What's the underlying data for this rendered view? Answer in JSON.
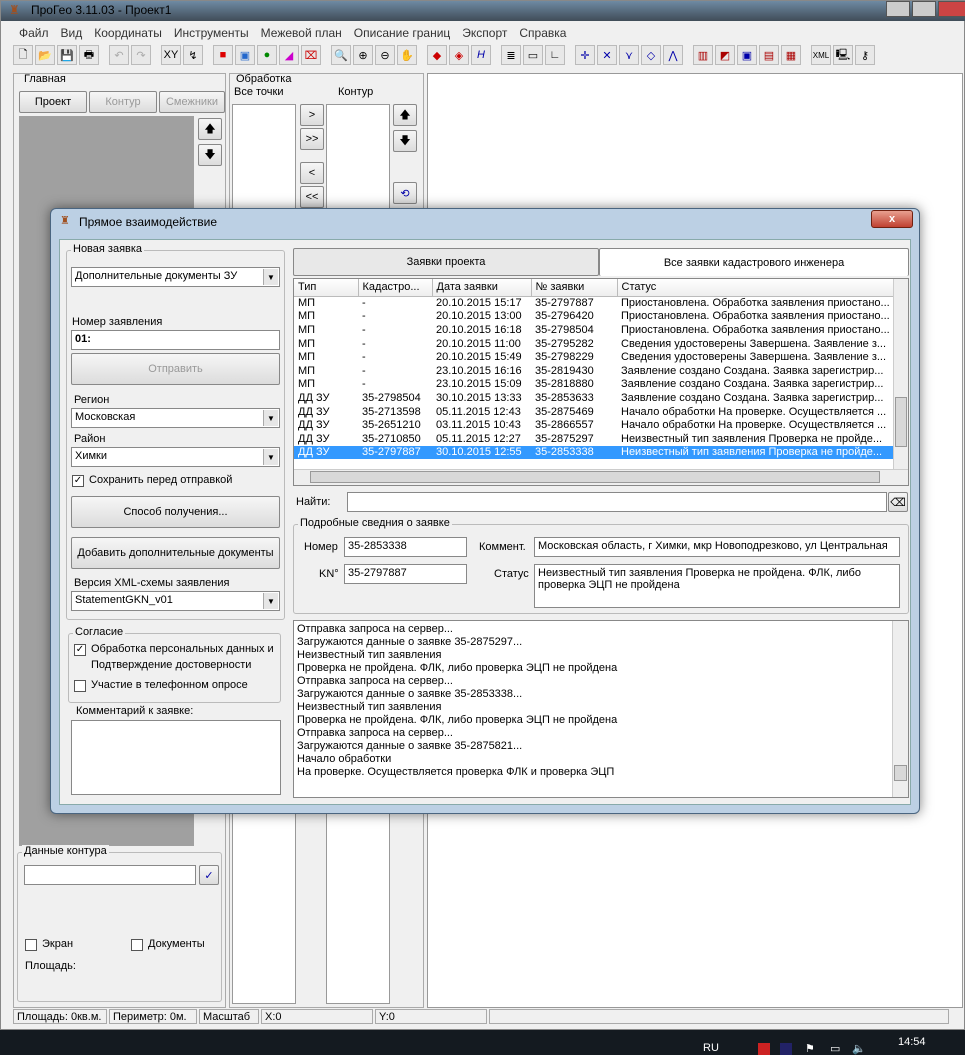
{
  "app": {
    "title": "ПроГео 3.11.03 - Проект1"
  },
  "menu": [
    "Файл",
    "Вид",
    "Координаты",
    "Инструменты",
    "Межевой план",
    "Описание границ",
    "Экспорт",
    "Справка"
  ],
  "main_panel": {
    "title": "Главная",
    "tabs": [
      "Проект",
      "Контур",
      "Смежники"
    ]
  },
  "processing_panel": {
    "title": "Обработка",
    "all_points": "Все точки",
    "contour": "Контур",
    "buttons": [
      ">",
      ">>",
      "<",
      "<<"
    ]
  },
  "contour_data": {
    "title": "Данные контура",
    "screen": "Экран",
    "documents": "Документы",
    "area": "Площадь:"
  },
  "statusbar": {
    "area": "Площадь: 0кв.м.",
    "perimeter": "Периметр: 0м.",
    "scale": "Масштаб",
    "x": "X:0",
    "y": "Y:0"
  },
  "taskbar": {
    "lang": "RU",
    "time": "14:54"
  },
  "dialog": {
    "title": "Прямое взаимодействие",
    "close": "x",
    "new_request": {
      "label": "Новая заявка",
      "type_value": "Дополнительные документы ЗУ",
      "number_label": "Номер заявления",
      "number_value": "01:",
      "send": "Отправить",
      "region_label": "Регион",
      "region_value": "Московская",
      "district_label": "Район",
      "district_value": "Химки",
      "save_before_send": "Сохранить перед отправкой",
      "receive_method": "Способ получения...",
      "add_docs": "Добавить дополнительные документы",
      "xml_version_label": "Версия XML-схемы заявления",
      "xml_version_value": "StatementGKN_v01"
    },
    "consent": {
      "label": "Согласие",
      "personal_data": "Обработка персональных данных и",
      "confirm": "Подтверждение достоверности",
      "phone_survey": "Участие в телефонном опросе"
    },
    "comment_label": "Комментарий к заявке:",
    "tabs": [
      "Заявки проекта",
      "Все заявки кадастрового инженера"
    ],
    "table": {
      "columns": [
        "Тип",
        "Кадастро...",
        "Дата заявки",
        "№ заявки",
        "Статус"
      ],
      "rows": [
        [
          "МП",
          "-",
          "20.10.2015 15:17",
          "35-2797887",
          "Приостановлена. Обработка заявления приостано..."
        ],
        [
          "МП",
          "-",
          "20.10.2015 13:00",
          "35-2796420",
          "Приостановлена. Обработка заявления приостано..."
        ],
        [
          "МП",
          "-",
          "20.10.2015 16:18",
          "35-2798504",
          "Приостановлена. Обработка заявления приостано..."
        ],
        [
          "МП",
          "-",
          "20.10.2015 11:00",
          "35-2795282",
          "Сведения удостоверены  Завершена. Заявление з..."
        ],
        [
          "МП",
          "-",
          "20.10.2015 15:49",
          "35-2798229",
          "Сведения удостоверены  Завершена. Заявление з..."
        ],
        [
          "МП",
          "-",
          "23.10.2015 16:16",
          "35-2819430",
          "Заявление создано  Создана. Заявка зарегистрир..."
        ],
        [
          "МП",
          "-",
          "23.10.2015 15:09",
          "35-2818880",
          "Заявление создано  Создана. Заявка зарегистрир..."
        ],
        [
          "ДД ЗУ",
          "35-2798504",
          "30.10.2015 13:33",
          "35-2853633",
          "Заявление создано  Создана. Заявка зарегистрир..."
        ],
        [
          "ДД ЗУ",
          "35-2713598",
          "05.11.2015 12:43",
          "35-2875469",
          "Начало обработки  На проверке. Осуществляется ..."
        ],
        [
          "ДД ЗУ",
          "35-2651210",
          "03.11.2015 10:43",
          "35-2866557",
          "Начало обработки  На проверке. Осуществляется ..."
        ],
        [
          "ДД ЗУ",
          "35-2710850",
          "05.11.2015 12:27",
          "35-2875297",
          "Неизвестный тип заявления  Проверка не пройде..."
        ],
        [
          "ДД ЗУ",
          "35-2797887",
          "30.10.2015 12:55",
          "35-2853338",
          "Неизвестный тип заявления  Проверка не пройде..."
        ]
      ],
      "selected_row": 11
    },
    "find_label": "Найти:",
    "find_value": "",
    "details": {
      "label": "Подробные сведния о заявке",
      "number_label": "Номер",
      "number_value": "35-2853338",
      "kn_label": "KN°",
      "kn_value": "35-2797887",
      "comment_label": "Коммент.",
      "comment_value": "Московская область, г Химки, мкр Новоподрезково, ул Центральная",
      "status_label": "Статус",
      "status_value": "Неизвестный тип заявления  Проверка не пройдена. ФЛК, либо проверка ЭЦП не пройдена"
    },
    "log": [
      "Отправка запроса на сервер...",
      "Загружаются данные о заявке 35-2875297...",
      "Неизвестный тип заявления",
      "Проверка не пройдена. ФЛК, либо проверка ЭЦП не пройдена",
      "Отправка запроса на сервер...",
      "Загружаются данные о заявке 35-2853338...",
      "Неизвестный тип заявления",
      "Проверка не пройдена. ФЛК, либо проверка ЭЦП не пройдена",
      "Отправка запроса на сервер...",
      "Загружаются данные о заявке 35-2875821...",
      "Начало обработки",
      "На проверке. Осуществляется проверка ФЛК и проверка ЭЦП"
    ]
  }
}
